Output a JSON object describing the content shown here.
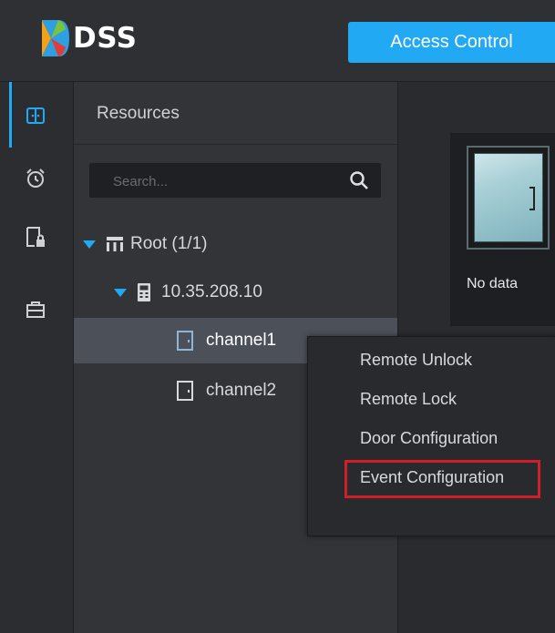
{
  "app": {
    "logo_text": "DSS",
    "module_button": "Access Control"
  },
  "colors": {
    "accent": "#22a9f4",
    "highlight_box": "#d01f28"
  },
  "nav_icons": [
    {
      "name": "access-control-icon",
      "active": true
    },
    {
      "name": "alarm-clock-icon",
      "active": false
    },
    {
      "name": "door-lock-icon",
      "active": false
    },
    {
      "name": "toolbox-icon",
      "active": false
    }
  ],
  "resources": {
    "title": "Resources",
    "search_placeholder": "Search...",
    "tree": {
      "root": "Root (1/1)",
      "device": "10.35.208.10",
      "channels": [
        "channel1",
        "channel2"
      ]
    }
  },
  "door_panel": {
    "status": "No data"
  },
  "context_menu": {
    "items": [
      "Remote Unlock",
      "Remote Lock",
      "Door Configuration",
      "Event Configuration"
    ],
    "highlighted": "Event Configuration"
  }
}
